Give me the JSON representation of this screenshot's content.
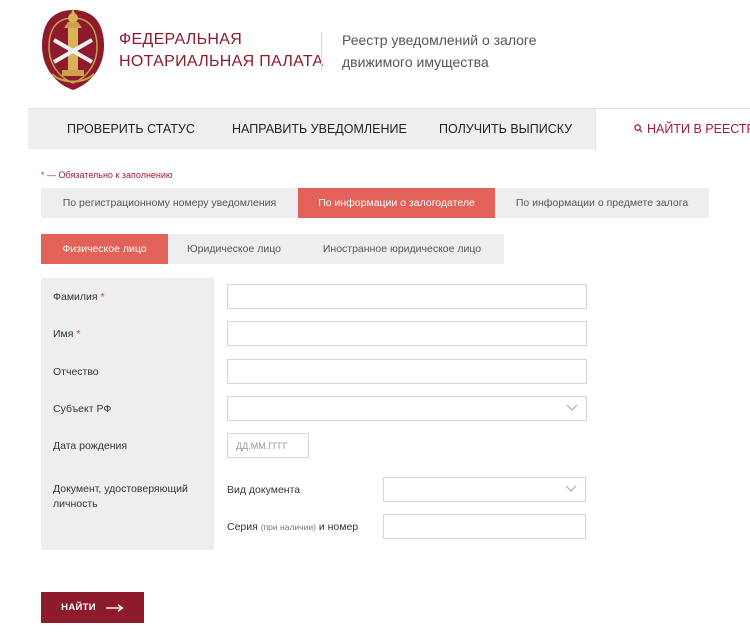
{
  "header": {
    "org_line1": "ФЕДЕРАЛЬНАЯ",
    "org_line2": "НОТАРИАЛЬНАЯ ПАЛАТА",
    "registry_line1": "Реестр уведомлений о залоге",
    "registry_line2": "движимого имущества"
  },
  "nav": {
    "items": [
      {
        "label": "ПРОВЕРИТЬ СТАТУС"
      },
      {
        "label": "НАПРАВИТЬ УВЕДОМЛЕНИЕ"
      },
      {
        "label": "ПОЛУЧИТЬ ВЫПИСКУ"
      },
      {
        "label": "НАЙТИ В РЕЕСТРЕ",
        "active": true
      }
    ]
  },
  "required_note": {
    "star": "*",
    "text": "— Обязательно к заполнению"
  },
  "search_tabs": [
    {
      "label": "По регистрационному номеру уведомления"
    },
    {
      "label": "По информации о залогодателе",
      "active": true
    },
    {
      "label": "По информации о предмете залога"
    }
  ],
  "person_tabs": [
    {
      "label": "Физическое лицо",
      "active": true
    },
    {
      "label": "Юридическое лицо"
    },
    {
      "label": "Иностранное юридическое лицо"
    }
  ],
  "form": {
    "surname_label": "Фамилия",
    "name_label": "Имя",
    "patronymic_label": "Отчество",
    "region_label": "Субъект РФ",
    "birthdate_label": "Дата рождения",
    "birthdate_placeholder": "ДД.ММ.ГГГГ",
    "document_label": "Документ, удостоверяющий личность",
    "doc_type_label": "Вид документа",
    "series_label_a": "Серия",
    "series_label_small": "(при наличии)",
    "series_label_b": "и номер",
    "required_star": "*"
  },
  "submit": {
    "label": "НАЙТИ"
  },
  "colors": {
    "brand": "#8d1b2c",
    "accent": "#e26158",
    "panel": "#eeeef0"
  }
}
